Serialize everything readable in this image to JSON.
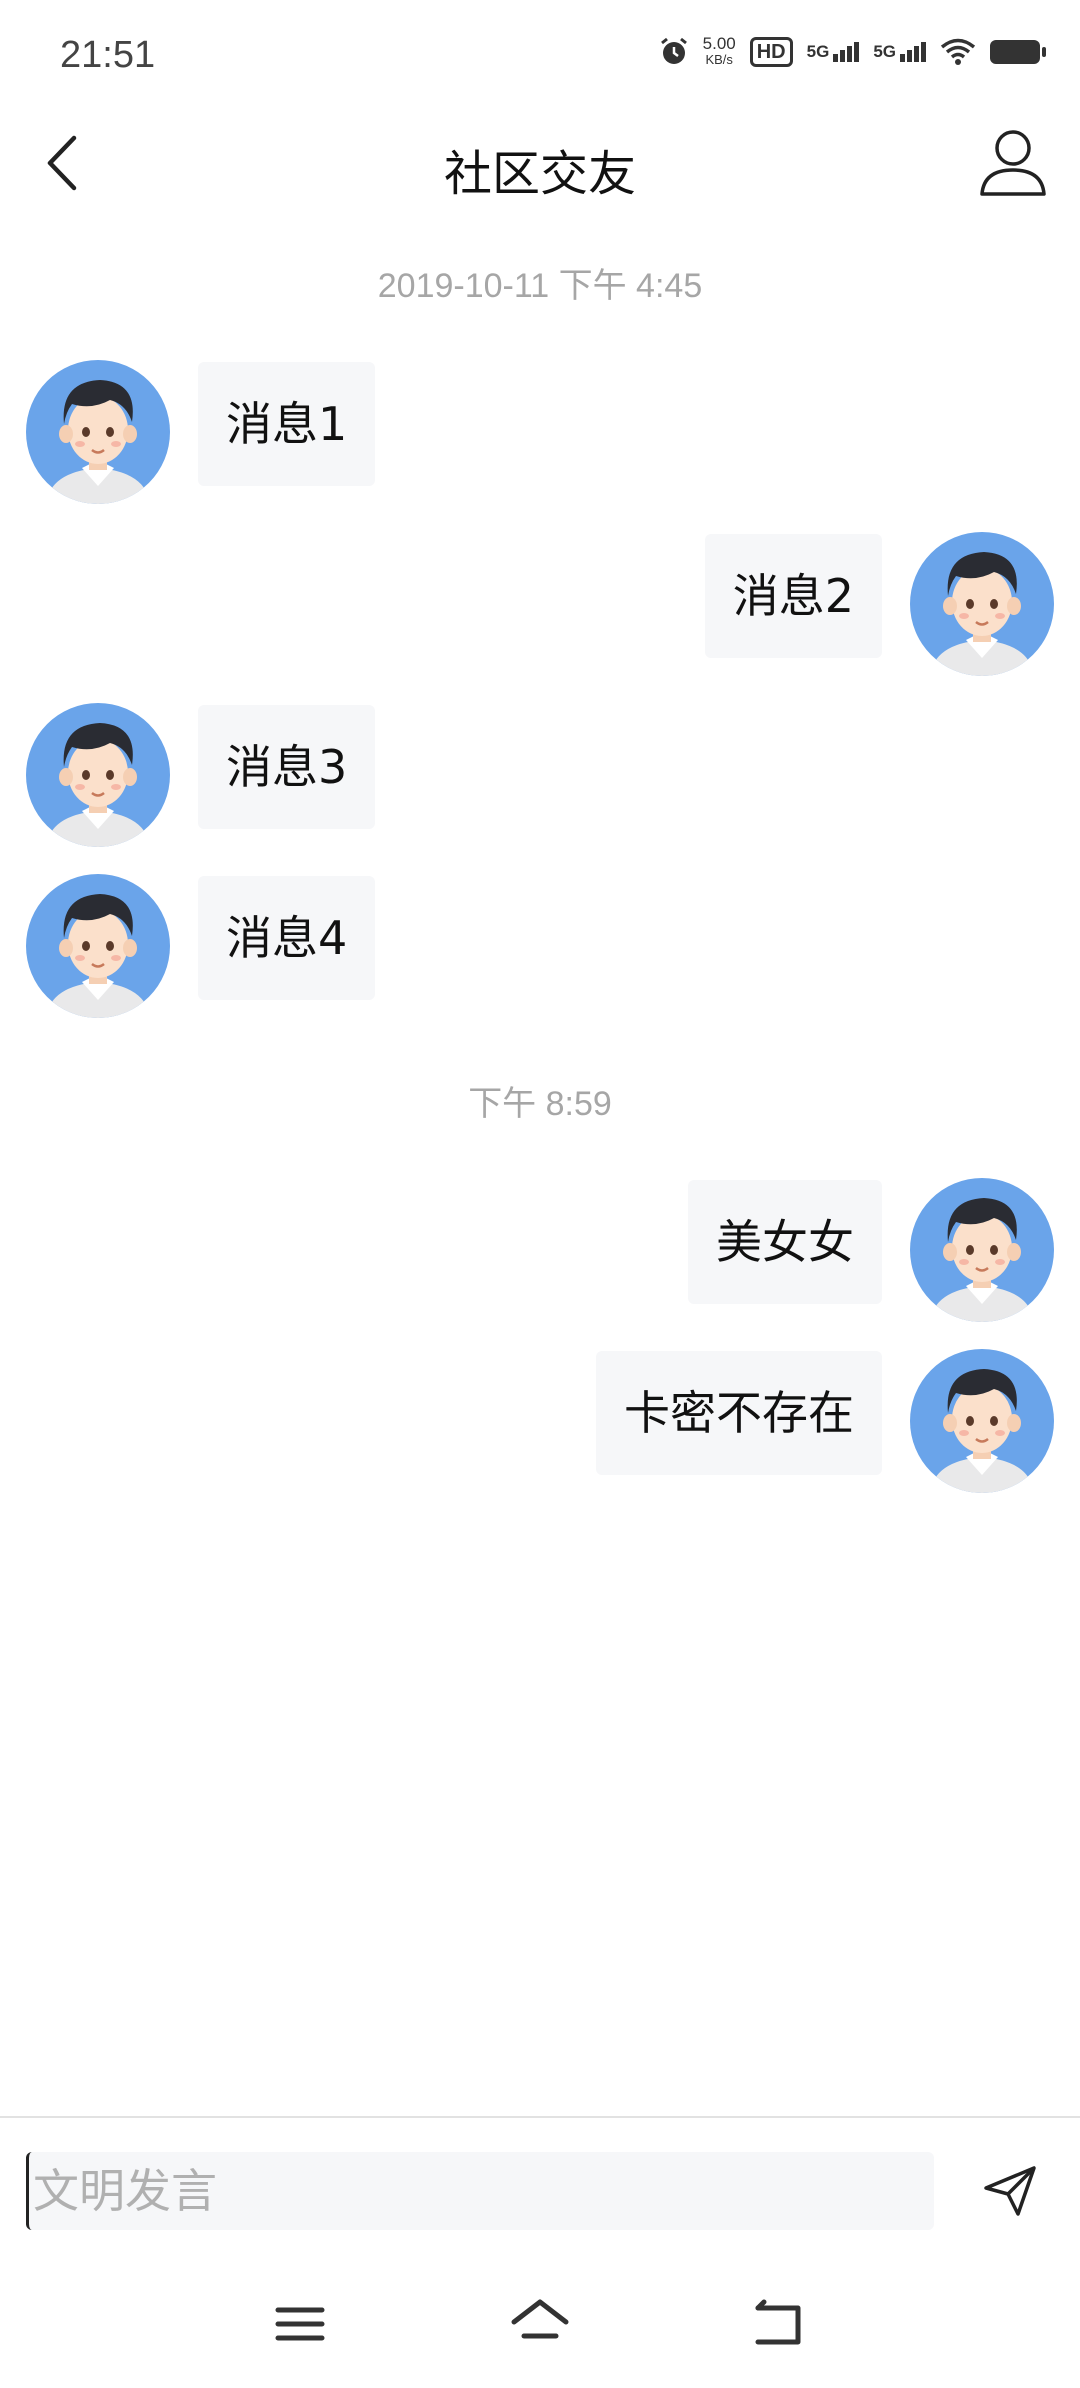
{
  "status_bar": {
    "time": "21:51",
    "net_speed_value": "5.00",
    "net_speed_unit": "KB/s",
    "hd_label": "HD",
    "sim1_label": "5G",
    "sim2_label": "5G"
  },
  "nav": {
    "title": "社区交友"
  },
  "timestamps": [
    "2019-10-11 下午 4:45",
    "下午 8:59"
  ],
  "messages": [
    {
      "side": "left",
      "text": "消息1"
    },
    {
      "side": "right",
      "text": "消息2"
    },
    {
      "side": "left",
      "text": "消息3"
    },
    {
      "side": "left",
      "text": "消息4"
    },
    {
      "side": "right",
      "text": "美女女"
    },
    {
      "side": "right",
      "text": "卡密不存在"
    }
  ],
  "input": {
    "placeholder": "文明发言",
    "value": ""
  },
  "colors": {
    "avatar_bg": "#6aa4ea",
    "bubble_bg": "#f6f7f9",
    "timestamp": "#a6a6a6"
  },
  "icons": {
    "back": "chevron-left-icon",
    "profile": "user-icon",
    "send": "paper-plane-icon",
    "menu": "menu-icon",
    "home": "home-icon",
    "return": "back-icon"
  }
}
